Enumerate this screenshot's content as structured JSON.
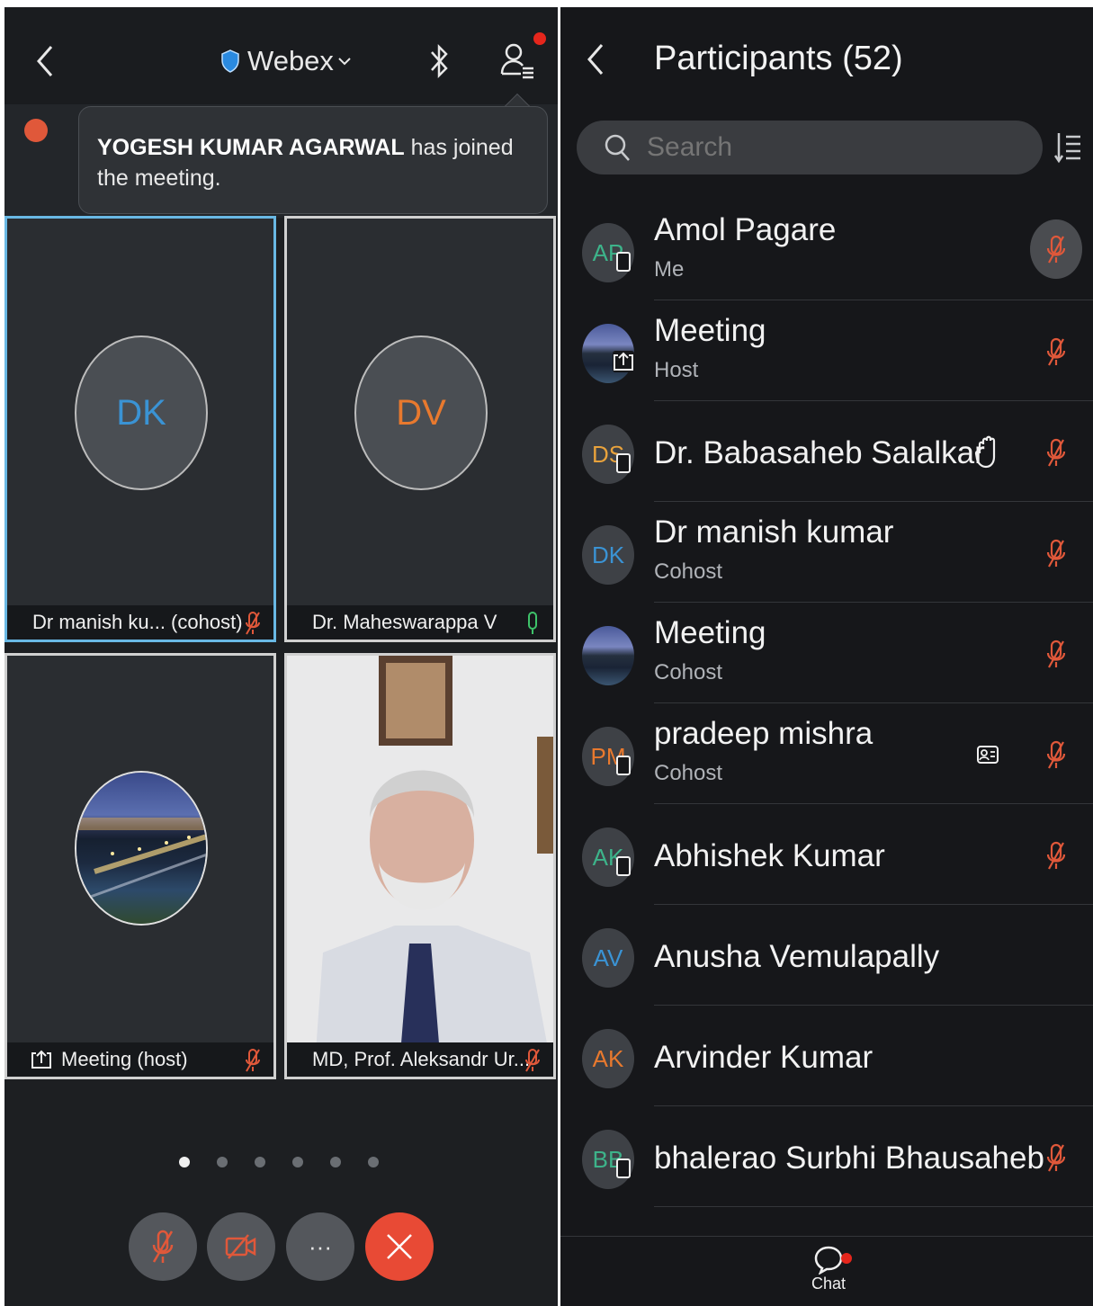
{
  "left": {
    "app_name": "Webex",
    "toast": {
      "name": "YOGESH KUMAR AGARWAL",
      "message": " has joined the meeting."
    },
    "tiles": [
      {
        "initials": "DK",
        "initials_color": "#3a93d4",
        "label": "Dr manish ku... (cohost)",
        "mic": "muted"
      },
      {
        "initials": "DV",
        "initials_color": "#e8792e",
        "label": "Dr. Maheswarappa V",
        "mic": "on"
      },
      {
        "initials": "",
        "label": "Meeting (host)",
        "mic": "muted",
        "sharing": true
      },
      {
        "initials": "",
        "label": "MD, Prof. Aleksandr Ur...",
        "mic": "muted"
      }
    ],
    "page_dots": {
      "count": 6,
      "active_index": 0
    },
    "controls": [
      "mute",
      "video",
      "more",
      "end"
    ],
    "more_label": "···"
  },
  "right": {
    "title": "Participants (52)",
    "search_placeholder": "Search",
    "participants": [
      {
        "initials": "AP",
        "initials_color": "#3db38a",
        "name": "Amol Pagare",
        "role": "Me",
        "device": true,
        "mic": "muted-circle"
      },
      {
        "initials": "",
        "photo": true,
        "name": "Meeting",
        "role": "Host",
        "sharing": true,
        "mic": "muted"
      },
      {
        "initials": "DS",
        "initials_color": "#e8a23c",
        "name": "Dr. Babasaheb Salalkar",
        "role": "",
        "device": true,
        "hand": true,
        "mic": "muted"
      },
      {
        "initials": "DK",
        "initials_color": "#3a93d4",
        "name": "Dr manish kumar",
        "role": "Cohost",
        "mic": "muted"
      },
      {
        "initials": "",
        "photo": true,
        "name": "Meeting",
        "role": "Cohost",
        "mic": "muted"
      },
      {
        "initials": "PM",
        "initials_color": "#e8792e",
        "name": "pradeep mishra",
        "role": "Cohost",
        "device": true,
        "card": true,
        "mic": "muted"
      },
      {
        "initials": "AK",
        "initials_color": "#3db38a",
        "name": "Abhishek Kumar",
        "role": "",
        "device": true,
        "mic": "muted"
      },
      {
        "initials": "AV",
        "initials_color": "#3a93d4",
        "name": "Anusha Vemulapally",
        "role": "",
        "mic": "none"
      },
      {
        "initials": "AK",
        "initials_color": "#e8792e",
        "name": "Arvinder Kumar",
        "role": "",
        "mic": "none"
      },
      {
        "initials": "BB",
        "initials_color": "#3db38a",
        "name": "bhalerao Surbhi Bhausaheb",
        "role": "",
        "device": true,
        "mic": "muted"
      }
    ],
    "chat_label": "Chat"
  },
  "colors": {
    "muted_mic": "#e0583a",
    "active_mic": "#3ec36a",
    "end_call": "#e84a35",
    "active_border": "#69b8e4"
  }
}
